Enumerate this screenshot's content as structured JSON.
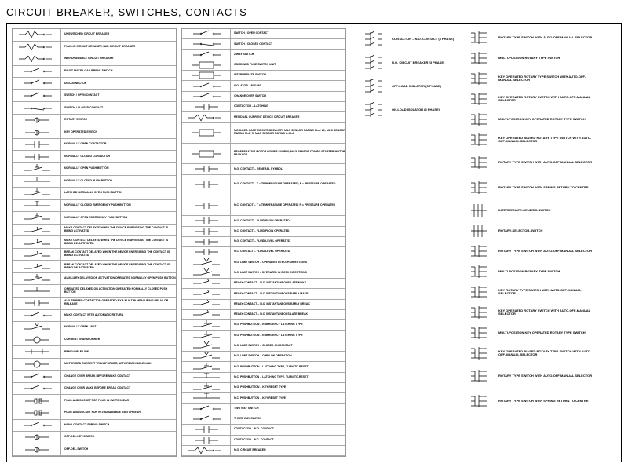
{
  "title": "CIRCUIT BREAKER, SWITCHES, CONTACTS",
  "col1": [
    "Unswitched Circuit Breaker",
    "Plug-in Circuit Breaker / Air Circuit Breaker",
    "Withdrawable Circuit Breaker",
    "Fault Make Load Break Switch",
    "Disconnector",
    "Switch / Open Contact",
    "Switch / Closed Contact",
    "Rotary Switch",
    "Key Operated Switch",
    "Normally Open Contactor",
    "Normally Closed Contactor",
    "Normally Open Push Button",
    "Normally Closed Push Button",
    "Latched Normally Open Push Button",
    "Normally Closed Emergency Push Button",
    "Normally Open Emergency Push Button",
    "Make Contact Delayed When The Device Energising The Contact Is Being Activated",
    "Make Contact Delayed When The Device Energising The Contact Is Being De-Activated",
    "Break Contact Delayed When The Device Energising The Contact Is Being Activated",
    "Break Contact Delayed When The Device Energising The Contact Is Being De-Activated",
    "Auxiliary Delayed On Activation Operated Normally Open Push Button",
    "Operated Delayed On Activation Operated Normally Closed Push Button",
    "Aux Tripped Contactor Operated By A Built-In Measuring Relay Or Release",
    "Make Contact With Automatic Return",
    "Normally Open Limit",
    "Current Transformer",
    "Removable Link",
    "Motorised Current Transformer, With Removable Link",
    "Change Over Break Before Make Contact",
    "Change Over Make Before Break Contact",
    "Plug And Socket For Plug In Switchgear",
    "Plug And Socket For Withdrawable Switchgear",
    "Hand-Contact Spring Switch",
    "Off-Del-Key-Switch",
    "Off-Del-Switch"
  ],
  "col2": [
    "Switch / Open Contact",
    "Switch / Closed Contact",
    "2 Way Switch",
    "Combined Fuse Switch Unit",
    "Intermediate Switch",
    "Isolator – MV1060",
    "Change Over Switch",
    "Contactor – Latching",
    "Residual Current Device Circuit Breaker",
    "Moulded Case Circuit Breaker; Mag Sensor Rating FLA+20; Mag Sensor Rating FLA+5; Mag Sensor Rating 2×FLA",
    "Regenerative Motor Power Supply; Mag Sensor Combo Starter Motor Package",
    "N.O. Contact – General Symbol",
    "N.O. Contact – T = Temperature Operated; P = Pressure Operated",
    "N.C. Contact – T = Temperature Operated; P = Pressure Operated",
    "N.O. Contact – Fluid Flow Operated",
    "N.C. Contact – Fluid Flow Operated",
    "N.O. Contact – Fluid Level Operated",
    "N.C. Contact – Fluid Level Operated",
    "N.O. Limit Switch – Operated In Both Directions",
    "N.C. Limit Switch – Operated In Both Directions",
    "Relay Contact – N.O. Instantaneous Late Make",
    "Relay Contact – N.C. Instantaneous Early Make",
    "Relay Contact – N.O. Instantaneous Early Break",
    "Relay Contact – N.C. Instantaneous Late Break",
    "N.O. Pushbutton – Emergency Latching Type",
    "N.O. Pushbutton – Emergency Latching Type",
    "N.O. Limit Switch – Closed On Contact",
    "N.O. Limit Switch – Open On Operation",
    "N.O. Pushbutton – Latching Type, Turn-To-Reset",
    "N.C. Pushbutton – Latching Type, Turn-To-Reset",
    "N.O. Pushbutton – Key Reset Type",
    "N.C. Pushbutton – Key Reset Type",
    "Two Way Switch",
    "Three Way Switch",
    "Contactor – N.O. Contact",
    "Contactor – N.C. Contact",
    "N.O. Circuit Breaker"
  ],
  "col3": [
    "Contactor – N.O. Contact (3 Phase)",
    "N.O. Circuit Breaker (3 Phase)",
    "Off-Load Isolator (3 Phase)",
    "On-Load Isolator (3 Phase)"
  ],
  "col4": [
    "Rotary Type Switch with Auto-Off-Manual Selector",
    "Multi-Position Rotary Type Switch",
    "Key Operated Rotary Type Switch with Auto-Off-Manual Selector",
    "Key Operated Rotary Switch with Auto-Off-Manual Selector",
    "Multi-Position Key Operated Rotary Type Switch",
    "Key Operated Biased Rotary Type Switch with Auto-Off-Manual Selector",
    "Rotary Type Switch with Auto-Off-Manual Selector",
    "Rotary Type Switch with Spring Return To Centre",
    "Intermediate-Generic-Switch",
    "Rotary-Selector-Switch",
    "Rotary Type Switch with Auto-Off-Manual Selector",
    "Multi-Position Rotary Type Switch",
    "Key Rotary Type Switch with Auto-Off-Manual Selector",
    "Key Operated Rotary Switch with Auto-Off-Manual Selector",
    "Multi-Position Key Operated Rotary Type Switch",
    "Key Operated Biased Rotary Type Switch with Auto-Off-Manual Selector",
    "Rotary Type Switch with Auto-Off-Manual Selector",
    "Rotary Type Switch with Spring Return To Centre"
  ]
}
